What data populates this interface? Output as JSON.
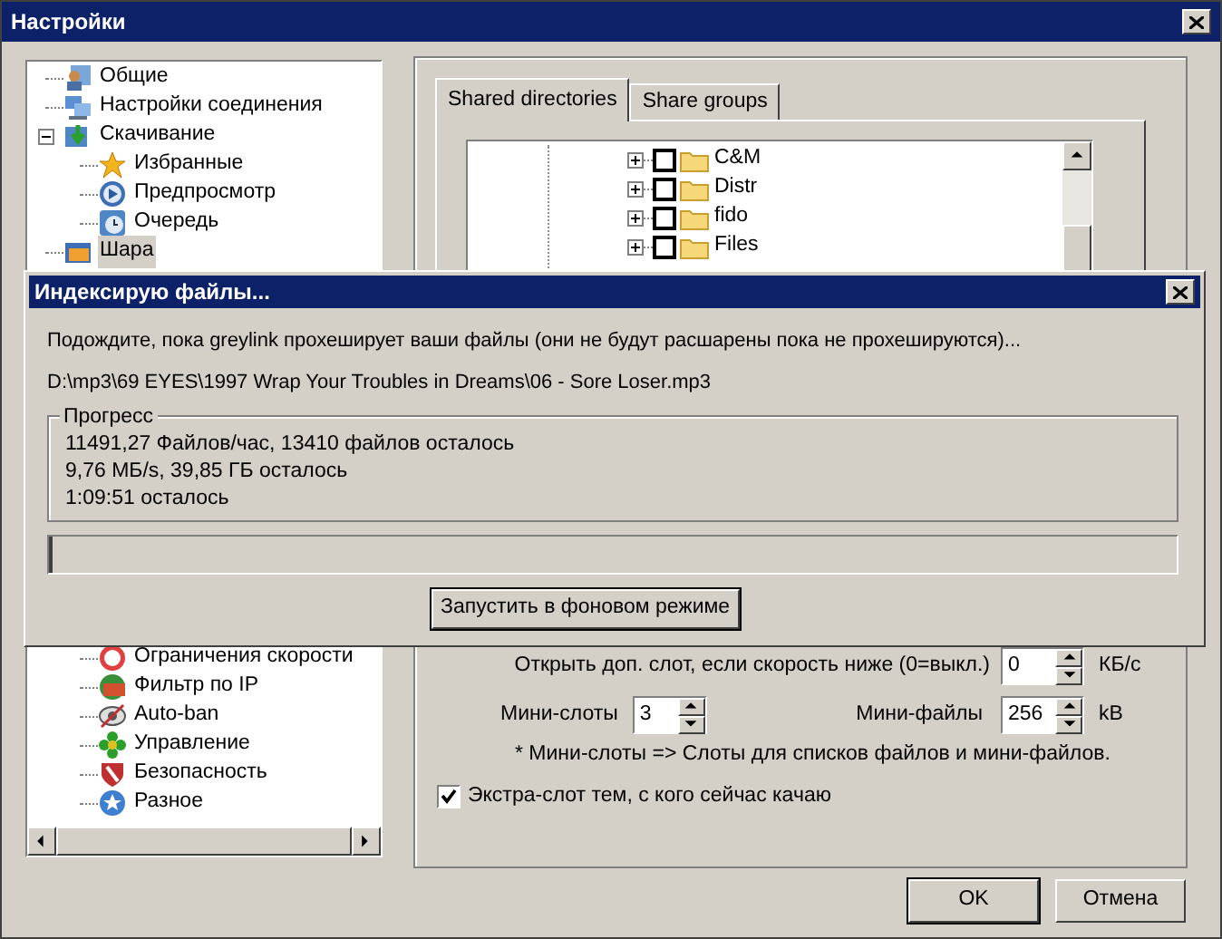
{
  "window": {
    "title": "Настройки"
  },
  "tree": {
    "items": [
      {
        "label": "Общие",
        "kind": "general",
        "selected": false
      },
      {
        "label": "Настройки соединения",
        "kind": "connection",
        "selected": false
      },
      {
        "label": "Скачивание",
        "kind": "download",
        "selected": false,
        "expanded": true,
        "children": [
          {
            "label": "Избранные",
            "kind": "favorites",
            "selected": false
          },
          {
            "label": "Предпросмотр",
            "kind": "preview",
            "selected": false
          },
          {
            "label": "Очередь",
            "kind": "queue",
            "selected": false
          }
        ]
      },
      {
        "label": "Шара",
        "kind": "share",
        "selected": true
      }
    ],
    "items_below": [
      {
        "label": "Ограничения скорости",
        "kind": "speed",
        "selected": false
      },
      {
        "label": "Фильтр по IP",
        "kind": "ipfilter",
        "selected": false
      },
      {
        "label": "Auto-ban",
        "kind": "autoban",
        "selected": false
      },
      {
        "label": "Управление",
        "kind": "control",
        "selected": false
      },
      {
        "label": "Безопасность",
        "kind": "security",
        "selected": false
      },
      {
        "label": "Разное",
        "kind": "misc",
        "selected": false
      }
    ]
  },
  "tabs": [
    {
      "label": "Shared directories",
      "selected": true
    },
    {
      "label": "Share groups",
      "selected": false
    }
  ],
  "directories": [
    {
      "name": "C&M",
      "checked": false,
      "expanded": false
    },
    {
      "name": "Distr",
      "checked": false,
      "expanded": false
    },
    {
      "name": "fido",
      "checked": false,
      "expanded": false
    },
    {
      "name": "Files",
      "checked": false,
      "expanded": false
    }
  ],
  "extra_slot": {
    "label": "Открыть доп. слот, если скорость ниже (0=выкл.)",
    "value": "0",
    "unit": "КБ/с"
  },
  "mini_slots": {
    "label": "Мини-слоты",
    "value": "3"
  },
  "mini_files": {
    "label": "Мини-файлы",
    "value": "256",
    "unit": "kB"
  },
  "note": "* Мини-слоты => Слоты для списков файлов и мини-файлов.",
  "extra_slot_checkbox": {
    "label": "Экстра-слот тем, с кого сейчас качаю",
    "checked": true
  },
  "buttons": [
    "OK",
    "Отмена"
  ],
  "dialog": {
    "title": "Индексирую файлы...",
    "message": "Подождите, пока greylink прохеширует ваши файлы (они не будут расшарены пока не прохешируются)...",
    "path": "D:\\mp3\\69 EYES\\1997 Wrap Your Troubles in Dreams\\06 - Sore Loser.mp3",
    "group_title": "Прогресс",
    "lines": [
      "11491,27 Файлов/час, 13410 файлов осталось",
      "9,76 МБ/s, 39,85 ГБ осталось",
      "1:09:51 осталось"
    ],
    "progress": {
      "level": 0.003
    },
    "button": "Запустить в фоновом режиме"
  }
}
